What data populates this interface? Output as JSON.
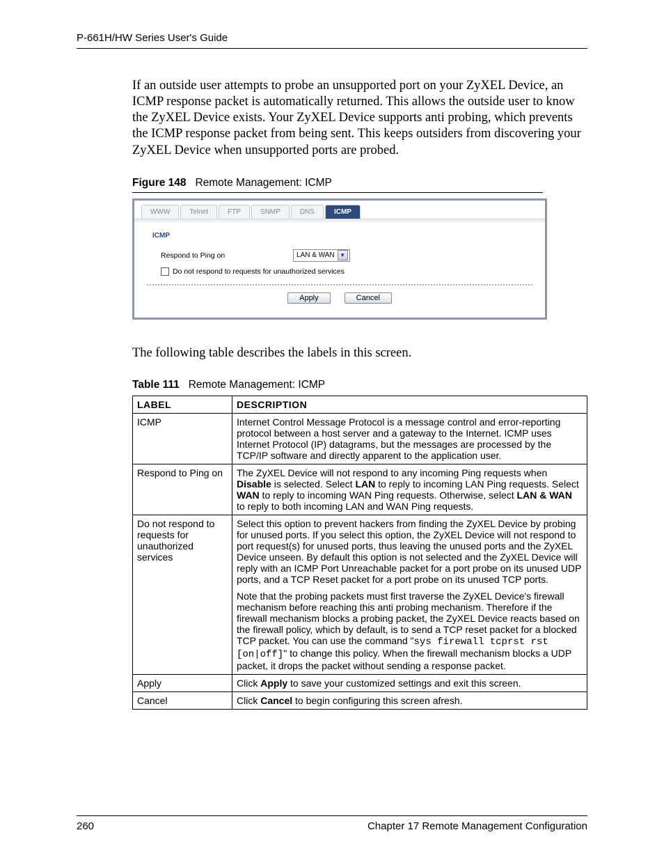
{
  "header": {
    "title": "P-661H/HW Series User's Guide"
  },
  "intro": "If an outside user attempts to probe an unsupported port on your ZyXEL Device, an ICMP response packet is automatically returned. This allows the outside user to know the ZyXEL Device exists. Your ZyXEL Device supports anti probing, which prevents the ICMP response packet from being sent. This keeps outsiders from discovering your ZyXEL Device when unsupported ports are probed.",
  "figure": {
    "label": "Figure 148",
    "title": "Remote Management: ICMP"
  },
  "screenshot": {
    "tabs": [
      "WWW",
      "Telnet",
      "FTP",
      "SNMP",
      "DNS",
      "ICMP"
    ],
    "active_tab": "ICMP",
    "section_title": "ICMP",
    "row_label": "Respond to Ping on",
    "select_value": "LAN & WAN",
    "checkbox_label": "Do not respond to requests for unauthorized services",
    "apply": "Apply",
    "cancel": "Cancel"
  },
  "midline": "The following table describes the labels in this screen.",
  "tablecap": {
    "label": "Table 111",
    "title": "Remote Management: ICMP"
  },
  "table": {
    "headers": [
      "LABEL",
      "DESCRIPTION"
    ],
    "rows": [
      {
        "label": "ICMP",
        "desc": "Internet Control Message Protocol is a message control and error-reporting protocol between a host server and a gateway to the Internet. ICMP uses Internet Protocol (IP) datagrams, but the messages are processed by the TCP/IP software and directly apparent to the application user."
      },
      {
        "label": "Respond to Ping on",
        "desc_pre": "The ZyXEL Device will not respond to any incoming Ping requests when ",
        "b1": "Disable",
        "desc_mid1": " is selected. Select ",
        "b2": "LAN",
        "desc_mid2": " to reply to incoming LAN Ping requests. Select ",
        "b3": "WAN",
        "desc_mid3": " to reply to incoming WAN Ping requests. Otherwise, select ",
        "b4": "LAN & WAN",
        "desc_post": " to reply to both incoming LAN and WAN Ping requests."
      },
      {
        "label": "Do not respond to requests for unauthorized services",
        "p1": "Select this option to prevent hackers from finding the ZyXEL Device by probing for unused ports. If you select this option, the ZyXEL Device will not respond to port request(s) for unused ports, thus leaving the unused ports and the ZyXEL Device unseen. By default this option is not selected and the ZyXEL Device will reply with an ICMP Port Unreachable packet for a port probe on its unused UDP ports, and a TCP Reset packet for a port probe on its unused TCP ports.",
        "p2_pre": "Note that the probing packets must first traverse the ZyXEL Device's firewall mechanism before reaching this anti probing mechanism. Therefore if the firewall mechanism blocks a probing packet, the ZyXEL Device reacts based on the firewall policy, which by default, is to send a TCP reset packet for a blocked TCP packet. You can use the command \"",
        "cmd": "sys firewall tcprst rst [on|off]",
        "p2_post": "\" to change this policy. When the firewall mechanism blocks a UDP packet, it drops the packet without sending a response packet."
      },
      {
        "label": "Apply",
        "desc_pre": "Click ",
        "b1": "Apply",
        "desc_post": " to save your customized settings and exit this screen."
      },
      {
        "label": "Cancel",
        "desc_pre": "Click ",
        "b1": "Cancel",
        "desc_post": " to begin configuring this screen afresh."
      }
    ]
  },
  "footer": {
    "page": "260",
    "chapter": "Chapter 17 Remote Management Configuration"
  }
}
